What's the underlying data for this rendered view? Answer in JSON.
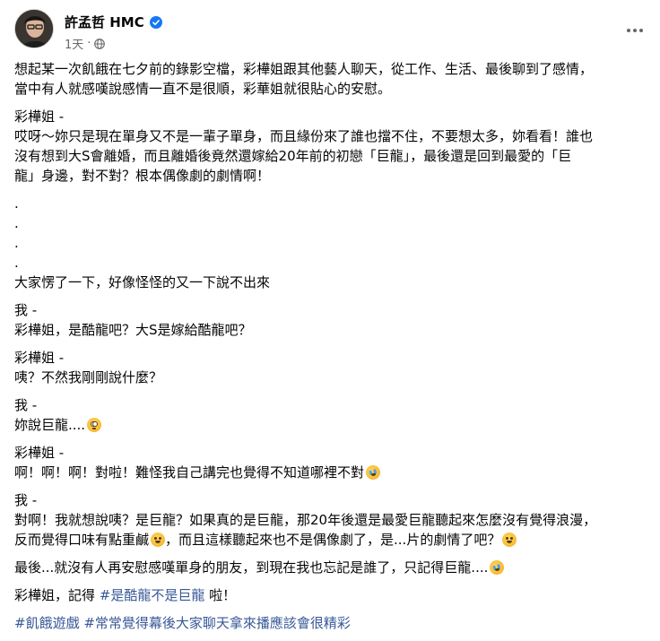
{
  "post": {
    "author": "許孟哲 HMC",
    "time": "1天",
    "paragraphs": [
      {
        "lines": [
          "想起某一次飢餓在七夕前的錄影空檔，彩樺姐跟其他藝人聊天，從工作、生活、最後聊到了感情，",
          "當中有人就感嘆說感情一直不是很順，彩華姐就很貼心的安慰。"
        ]
      },
      {
        "lines": [
          "彩樺姐 -",
          "哎呀～妳只是現在單身又不是一輩子單身，而且緣份來了誰也擋不住，不要想太多，妳看看！誰也",
          "沒有想到大S會離婚，而且離婚後竟然還嫁給20年前的初戀「巨龍」，最後還是回到最愛的「巨",
          "龍」身邊，對不對？根本偶像劇的劇情啊！"
        ]
      },
      {
        "dots": [
          ".",
          ".",
          ".",
          "."
        ]
      },
      {
        "lines": [
          "大家愣了一下，好像怪怪的又一下說不出來"
        ]
      },
      {
        "lines": [
          "我 -",
          "彩樺姐，是酷龍吧？大S是嫁給酷龍吧？"
        ]
      },
      {
        "lines": [
          "彩樺姐 -",
          "咦？不然我剛剛說什麼？"
        ]
      },
      {
        "lines": [
          "我 -",
          "妳說巨龍...."
        ]
      },
      {
        "lines": [
          "彩樺姐 -",
          "啊！啊！啊！對啦！難怪我自己講完也覺得不知道哪裡不對"
        ]
      },
      {
        "lines": [
          "我 -",
          "對啊！我就想說咦？是巨龍？如果真的是巨龍，那20年後還是最愛巨龍聽起來怎麼沒有覺得浪漫，",
          "反而覺得口味有點重鹹",
          "，而且這樣聽起來也不是偶像劇了，是...片的劇情了吧？"
        ]
      },
      {
        "lines": [
          "最後...就沒有人再安慰感嘆單身的朋友，到現在我也忘記是誰了，只記得巨龍...."
        ]
      },
      {
        "lines": [
          "彩樺姐，記得 ",
          "#是酷龍不是巨龍",
          " 啦！"
        ]
      },
      {
        "tags": [
          "#飢餓遊戲",
          "#常常覺得幕後大家聊天拿來播應該會很精彩"
        ]
      }
    ]
  },
  "icons": {
    "verified": "verified-badge-icon",
    "globe": "globe-icon",
    "more": "more-options-icon",
    "emoji_flushed": "flushed-face-emoji-icon",
    "emoji_rofl": "rolling-on-floor-laughing-emoji-icon",
    "emoji_grin_sweat": "grinning-sweat-emoji-icon"
  },
  "colors": {
    "link": "#385898",
    "meta": "#65676b",
    "verified": "#1877f2"
  }
}
